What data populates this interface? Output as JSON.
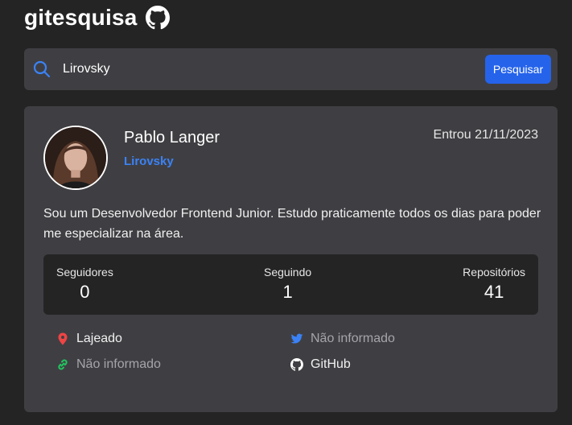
{
  "header": {
    "brand": "gitesquisa",
    "logo_icon": "github-icon"
  },
  "search": {
    "value": "Lirovsky",
    "button_label": "Pesquisar",
    "icon": "search-icon",
    "button_color": "#2563eb"
  },
  "profile": {
    "name": "Pablo Langer",
    "login": "Lirovsky",
    "joined": "Entrou 21/11/2023",
    "bio": "Sou um Desenvolvedor Frontend Junior. Estudo praticamente todos os dias para poder me especializar na área.",
    "avatar_icon": "avatar"
  },
  "stats": [
    {
      "label": "Seguidores",
      "value": "0"
    },
    {
      "label": "Seguindo",
      "value": "1"
    },
    {
      "label": "Repositórios",
      "value": "41"
    }
  ],
  "links": {
    "location": {
      "text": "Lajeado",
      "icon": "location-pin-icon",
      "color": "#ef4444"
    },
    "twitter": {
      "text": "Não informado",
      "icon": "twitter-icon",
      "color": "#3b82f6"
    },
    "blog": {
      "text": "Não informado",
      "icon": "link-icon",
      "color": "#22c55e"
    },
    "github": {
      "text": "GitHub",
      "icon": "github-icon",
      "color": "#ffffff"
    }
  }
}
